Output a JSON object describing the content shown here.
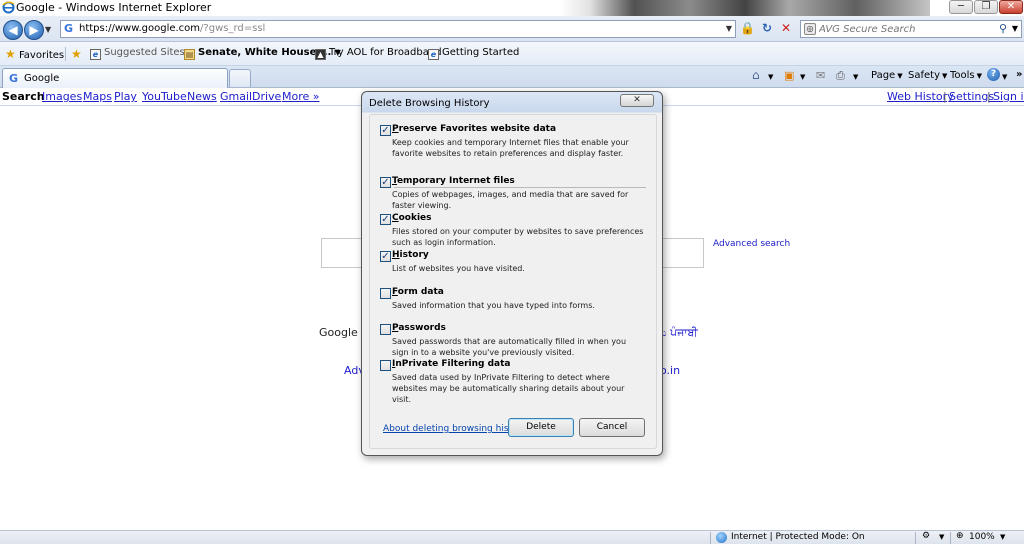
{
  "window": {
    "title": "Google - Windows Internet Explorer",
    "min_glyph": "─",
    "max_glyph": "❐",
    "close_glyph": "✕"
  },
  "address": {
    "url_main": "https://www.google.com",
    "url_rest": "/?gws_rd=ssl",
    "search_placeholder": "AVG Secure Search"
  },
  "favorites_bar": {
    "favorites_label": "Favorites",
    "items": [
      {
        "label": "Suggested Sites ▾"
      },
      {
        "label": "Senate, White House ..."
      },
      {
        "label": "Try AOL for Broadband"
      },
      {
        "label": "Getting Started"
      }
    ]
  },
  "tabs": [
    {
      "label": "Google"
    }
  ],
  "command_bar": {
    "page_label": "Page",
    "safety_label": "Safety",
    "tools_label": "Tools"
  },
  "google_nav": {
    "current": "Search",
    "links": [
      "Images",
      "Maps",
      "Play",
      "YouTube",
      "News",
      "Gmail",
      "Drive",
      "More »"
    ],
    "right_links": [
      "Web History",
      "Settings",
      "Sign in"
    ],
    "separator": "|"
  },
  "google_page": {
    "advanced_search": "Advanced search",
    "offered_prefix": "Google off",
    "lang_suffix": "ಲು  ਪੰਜਾਬੀ",
    "adv_prefix": "Adve",
    "domain_suffix": "o.in"
  },
  "dialog": {
    "title": "Delete Browsing History",
    "options": [
      {
        "checked": true,
        "name_key": "P",
        "name_rest": "reserve Favorites website data",
        "desc": "Keep cookies and temporary Internet files that enable your favorite websites to retain preferences and display faster."
      },
      {
        "checked": true,
        "name_key": "T",
        "name_rest": "emporary Internet files",
        "desc": "Copies of webpages, images, and media that are saved for faster viewing."
      },
      {
        "checked": true,
        "name_key": "C",
        "name_rest": "ookies",
        "desc": "Files stored on your computer by websites to save preferences such as login information."
      },
      {
        "checked": true,
        "name_key": "H",
        "name_rest": "istory",
        "desc": "List of websites you have visited."
      },
      {
        "checked": false,
        "name_key": "F",
        "name_rest": "orm data",
        "desc": "Saved information that you have typed into forms."
      },
      {
        "checked": false,
        "name_key": "P",
        "name_rest": "asswords",
        "desc": "Saved passwords that are automatically filled in when you sign in to a website you've previously visited."
      },
      {
        "checked": false,
        "name_key": "I",
        "name_rest": "nPrivate Filtering data",
        "desc": "Saved data used by InPrivate Filtering to detect where websites may be automatically sharing details about your visit."
      }
    ],
    "about_link": "About deleting browsing history",
    "delete_label": "Delete",
    "cancel_label": "Cancel"
  },
  "status_bar": {
    "zone": "Internet | Protected Mode: On",
    "zoom": "100%"
  }
}
